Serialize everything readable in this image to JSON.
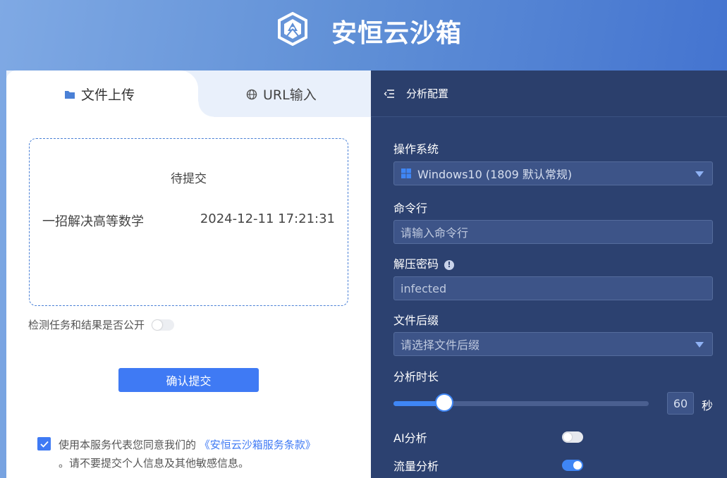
{
  "header": {
    "brand": "安恒云沙箱",
    "logo": "shield-logo-icon"
  },
  "tabs": [
    {
      "label": "文件上传",
      "icon": "folder-icon",
      "active": true
    },
    {
      "label": "URL输入",
      "icon": "globe-icon",
      "active": false
    }
  ],
  "upload": {
    "status": "待提交",
    "file_name": "一招解决高等数学",
    "file_time": "2024-12-11 17:21:31"
  },
  "public_option": {
    "label": "检测任务和结果是否公开",
    "enabled": false
  },
  "submit_label": "确认提交",
  "agreement": {
    "checked": true,
    "prefix": "使用本服务代表您同意我们的",
    "link": "《安恒云沙箱服务条款》",
    "suffix": "。请不要提交个人信息及其他敏感信息。"
  },
  "config": {
    "title": "分析配置",
    "os": {
      "label": "操作系统",
      "value": "Windows10 (1809 默认常规)",
      "icon": "windows-icon"
    },
    "cmdline": {
      "label": "命令行",
      "placeholder": "请输入命令行"
    },
    "password": {
      "label": "解压密码",
      "value": "infected",
      "icon": "info-icon"
    },
    "suffix": {
      "label": "文件后缀",
      "placeholder": "请选择文件后缀"
    },
    "duration": {
      "label": "分析时长",
      "value": "60",
      "unit": "秒",
      "fill_fraction": 0.2
    },
    "ai": {
      "label": "AI分析",
      "enabled": false
    },
    "traffic": {
      "label": "流量分析",
      "enabled": true
    }
  }
}
